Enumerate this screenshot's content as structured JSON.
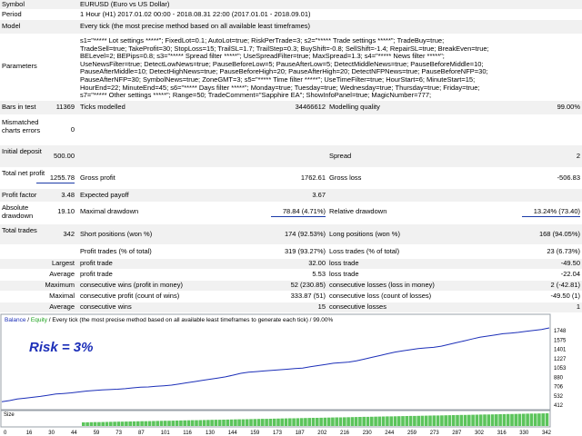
{
  "header": {
    "symbol_label": "Symbol",
    "symbol_value": "EURUSD (Euro vs US Dollar)",
    "period_label": "Period",
    "period_value": "1 Hour (H1) 2017.01.02 00:00 - 2018.08.31 22:00 (2017.01.01 - 2018.09.01)",
    "model_label": "Model",
    "model_value": "Every tick (the most precise method based on all available least timeframes)",
    "parameters_label": "Parameters",
    "parameters_lines": [
      "s1=\"***** Lot settings *****\"; FixedLot=0.1; AutoLot=true; RiskPerTrade=3; s2=\"***** Trade settings *****\"; TradeBuy=true;",
      "TradeSell=true; TakeProfit=30; StopLoss=15; TrailSL=1.7; TrailStep=0.3; BuyShift=-0.8; SellShift=-1.4; RepairSL=true; BreakEven=true;",
      "BELevel=2; BEPips=0.8; s3=\"***** Spread filter *****\"; UseSpreadFilter=true; MaxSpread=1.3; s4=\"***** News filter *****\";",
      "UseNewsFilter=true; DetectLowNews=true; PauseBeforeLow=5; PauseAfterLow=5; DetectMiddleNews=true; PauseBeforeMiddle=10;",
      "PauseAfterMiddle=10; DetectHighNews=true; PauseBeforeHigh=20; PauseAfterHigh=20; DetectNFPNews=true; PauseBeforeNFP=30;",
      "PauseAfterNFP=30; SymbolNews=true; ZoneGMT=3; s5=\"***** Time filter *****\"; UseTimeFilter=true; HourStart=6; MinuteStart=15;",
      "HourEnd=22; MinuteEnd=45; s6=\"***** Days filter *****\"; Monday=true; Tuesday=true; Wednesday=true; Thursday=true; Friday=true;",
      "s7=\"***** Other settings *****\"; Range=50; TradeComment=\"Sapphire EA\"; ShowInfoPanel=true; MagicNumber=777;"
    ]
  },
  "stats": {
    "bars_label": "Bars in test",
    "bars_value": "11369",
    "ticks_label": "Ticks modelled",
    "ticks_value": "34466612",
    "quality_label": "Modelling quality",
    "quality_value": "99.00%",
    "mismatch_label": "Mismatched charts errors",
    "mismatch_value": "0",
    "deposit_label": "Initial deposit",
    "deposit_value": "500.00",
    "spread_label": "Spread",
    "spread_value": "2",
    "net_label": "Total net profit",
    "net_value": "1255.78",
    "gross_profit_label": "Gross profit",
    "gross_profit_value": "1762.61",
    "gross_loss_label": "Gross loss",
    "gross_loss_value": "-506.83",
    "pf_label": "Profit factor",
    "pf_value": "3.48",
    "payoff_label": "Expected payoff",
    "payoff_value": "3.67",
    "abs_dd_label": "Absolute drawdown",
    "abs_dd_value": "19.10",
    "max_dd_label": "Maximal drawdown",
    "max_dd_value": "78.84 (4.71%)",
    "rel_dd_label": "Relative drawdown",
    "rel_dd_value": "13.24% (73.40)",
    "total_label": "Total trades",
    "total_value": "342",
    "short_label": "Short positions (won %)",
    "short_value": "174 (92.53%)",
    "long_label": "Long positions (won %)",
    "long_value": "168 (94.05%)",
    "pt_label": "Profit trades (% of total)",
    "pt_value": "319 (93.27%)",
    "lt_label": "Loss trades (% of total)",
    "lt_value": "23 (6.73%)",
    "largest_label": "Largest",
    "lpt_label": "profit trade",
    "lpt_value": "32.00",
    "llt_label": "loss trade",
    "llt_value": "-49.50",
    "average_label": "Average",
    "apt_label": "profit trade",
    "apt_value": "5.53",
    "alt_label": "loss trade",
    "alt_value": "-22.04",
    "maximum_label": "Maximum",
    "mcw_label": "consecutive wins (profit in money)",
    "mcw_value": "52 (230.85)",
    "mcl_label": "consecutive losses (loss in money)",
    "mcl_value": "2 (-42.81)",
    "maximal_label": "Maximal",
    "mcp_label": "consecutive profit (count of wins)",
    "mcp_value": "333.87 (51)",
    "mclc_label": "consecutive loss (count of losses)",
    "mclc_value": "-49.50 (1)",
    "average2_label": "Average",
    "acw_label": "consecutive wins",
    "acw_value": "15",
    "acl_label": "consecutive losses",
    "acl_value": "1"
  },
  "chart": {
    "legend_balance": "Balance",
    "legend_sep": " / ",
    "legend_equity": "Equity",
    "legend_rest": " / Every tick (the most precise method based on all available least timeframes to generate each tick) / 99.00%",
    "annotation": "Risk = 3%",
    "size_label": "Size",
    "colors": {
      "balance": "#1c2fb8",
      "equity": "#1aa01a",
      "size_bar": "#5cc45c",
      "legend_balance": "#1c2fb8",
      "legend_equity": "#1aa01a",
      "annotation": "#1c2fb8"
    }
  },
  "chart_data": {
    "type": "line",
    "series": [
      {
        "name": "Balance",
        "values": [
          500,
          520,
          545,
          560,
          575,
          590,
          610,
          630,
          640,
          650,
          665,
          680,
          690,
          700,
          705,
          712,
          720,
          735,
          745,
          750,
          760,
          770,
          780,
          800,
          820,
          840,
          860,
          880,
          900,
          920,
          950,
          980,
          1000,
          1010,
          1020,
          1030,
          1040,
          1050,
          1060,
          1070,
          1090,
          1110,
          1130,
          1150,
          1160,
          1170,
          1190,
          1220,
          1250,
          1280,
          1310,
          1340,
          1360,
          1380,
          1400,
          1410,
          1420,
          1440,
          1470,
          1500,
          1530,
          1560,
          1590,
          1610,
          1630,
          1650,
          1660,
          1672,
          1690,
          1705,
          1720,
          1748
        ]
      }
    ],
    "x_ticks": [
      "0",
      "16",
      "30",
      "44",
      "59",
      "73",
      "87",
      "101",
      "116",
      "130",
      "144",
      "159",
      "173",
      "187",
      "202",
      "216",
      "230",
      "244",
      "259",
      "273",
      "287",
      "302",
      "316",
      "330",
      "342"
    ],
    "y_ticks": [
      "1748",
      "1575",
      "1401",
      "1227",
      "1053",
      "880",
      "706",
      "532",
      "412"
    ],
    "ylim": [
      412,
      1748
    ]
  }
}
